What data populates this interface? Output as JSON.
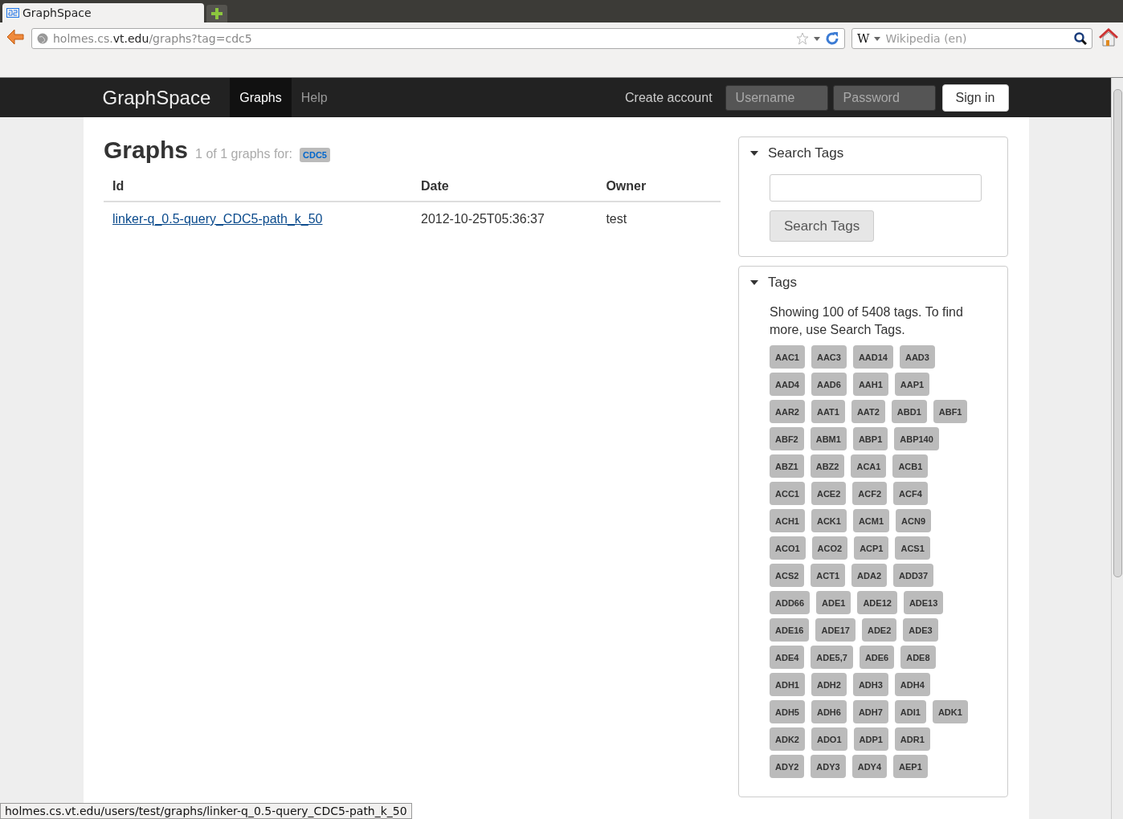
{
  "browser": {
    "tabs": [
      {
        "title": "GraphSpace",
        "selected": true
      }
    ],
    "address": {
      "host_prefix": "holmes.cs.",
      "host_domain": "vt.edu",
      "path": "/graphs?tag=cdc5"
    },
    "search": {
      "engine": "W",
      "placeholder": "Wikipedia (en)"
    },
    "status_url": "holmes.cs.vt.edu/users/test/graphs/linker-q_0.5-query_CDC5-path_k_50"
  },
  "navbar": {
    "brand": "GraphSpace",
    "links": [
      {
        "label": "Graphs",
        "selected": true
      },
      {
        "label": "Help",
        "selected": false
      }
    ],
    "create_account": "Create account",
    "username": {
      "placeholder": "Username"
    },
    "password": {
      "placeholder": "Password"
    },
    "sign_in": "Sign in"
  },
  "main": {
    "title": "Graphs",
    "subtitle": "1 of 1 graphs for:",
    "tag": "CDC5",
    "table": {
      "columns": [
        "Id",
        "Date",
        "Owner"
      ],
      "rows": [
        {
          "id": "linker-q_0.5-query_CDC5-path_k_50",
          "date": "2012-10-25T05:36:37",
          "owner": "test"
        }
      ]
    }
  },
  "sidebar": {
    "search_panel": {
      "title": "Search Tags",
      "expanded": true,
      "button": "Search Tags"
    },
    "tags_panel": {
      "title": "Tags",
      "expanded": true,
      "note": "Showing 100 of 5408 tags. To find more, use Search Tags.",
      "tag_rows": [
        [
          "AAC1",
          "AAC3",
          "AAD14",
          "AAD3"
        ],
        [
          "AAD4",
          "AAD6",
          "AAH1",
          "AAP1"
        ],
        [
          "AAR2",
          "AAT1",
          "AAT2",
          "ABD1",
          "ABF1"
        ],
        [
          "ABF2",
          "ABM1",
          "ABP1",
          "ABP140"
        ],
        [
          "ABZ1",
          "ABZ2",
          "ACA1",
          "ACB1"
        ],
        [
          "ACC1",
          "ACE2",
          "ACF2",
          "ACF4"
        ],
        [
          "ACH1",
          "ACK1",
          "ACM1",
          "ACN9"
        ],
        [
          "ACO1",
          "ACO2",
          "ACP1",
          "ACS1"
        ],
        [
          "ACS2",
          "ACT1",
          "ADA2",
          "ADD37"
        ],
        [
          "ADD66",
          "ADE1",
          "ADE12",
          "ADE13"
        ],
        [
          "ADE16",
          "ADE17",
          "ADE2",
          "ADE3"
        ],
        [
          "ADE4",
          "ADE5,7",
          "ADE6",
          "ADE8"
        ],
        [
          "ADH1",
          "ADH2",
          "ADH3",
          "ADH4"
        ],
        [
          "ADH5",
          "ADH6",
          "ADH7",
          "ADI1",
          "ADK1"
        ],
        [
          "ADK2",
          "ADO1",
          "ADP1",
          "ADR1"
        ],
        [
          "ADY2",
          "ADY3",
          "ADY4",
          "AEP1"
        ]
      ]
    }
  }
}
